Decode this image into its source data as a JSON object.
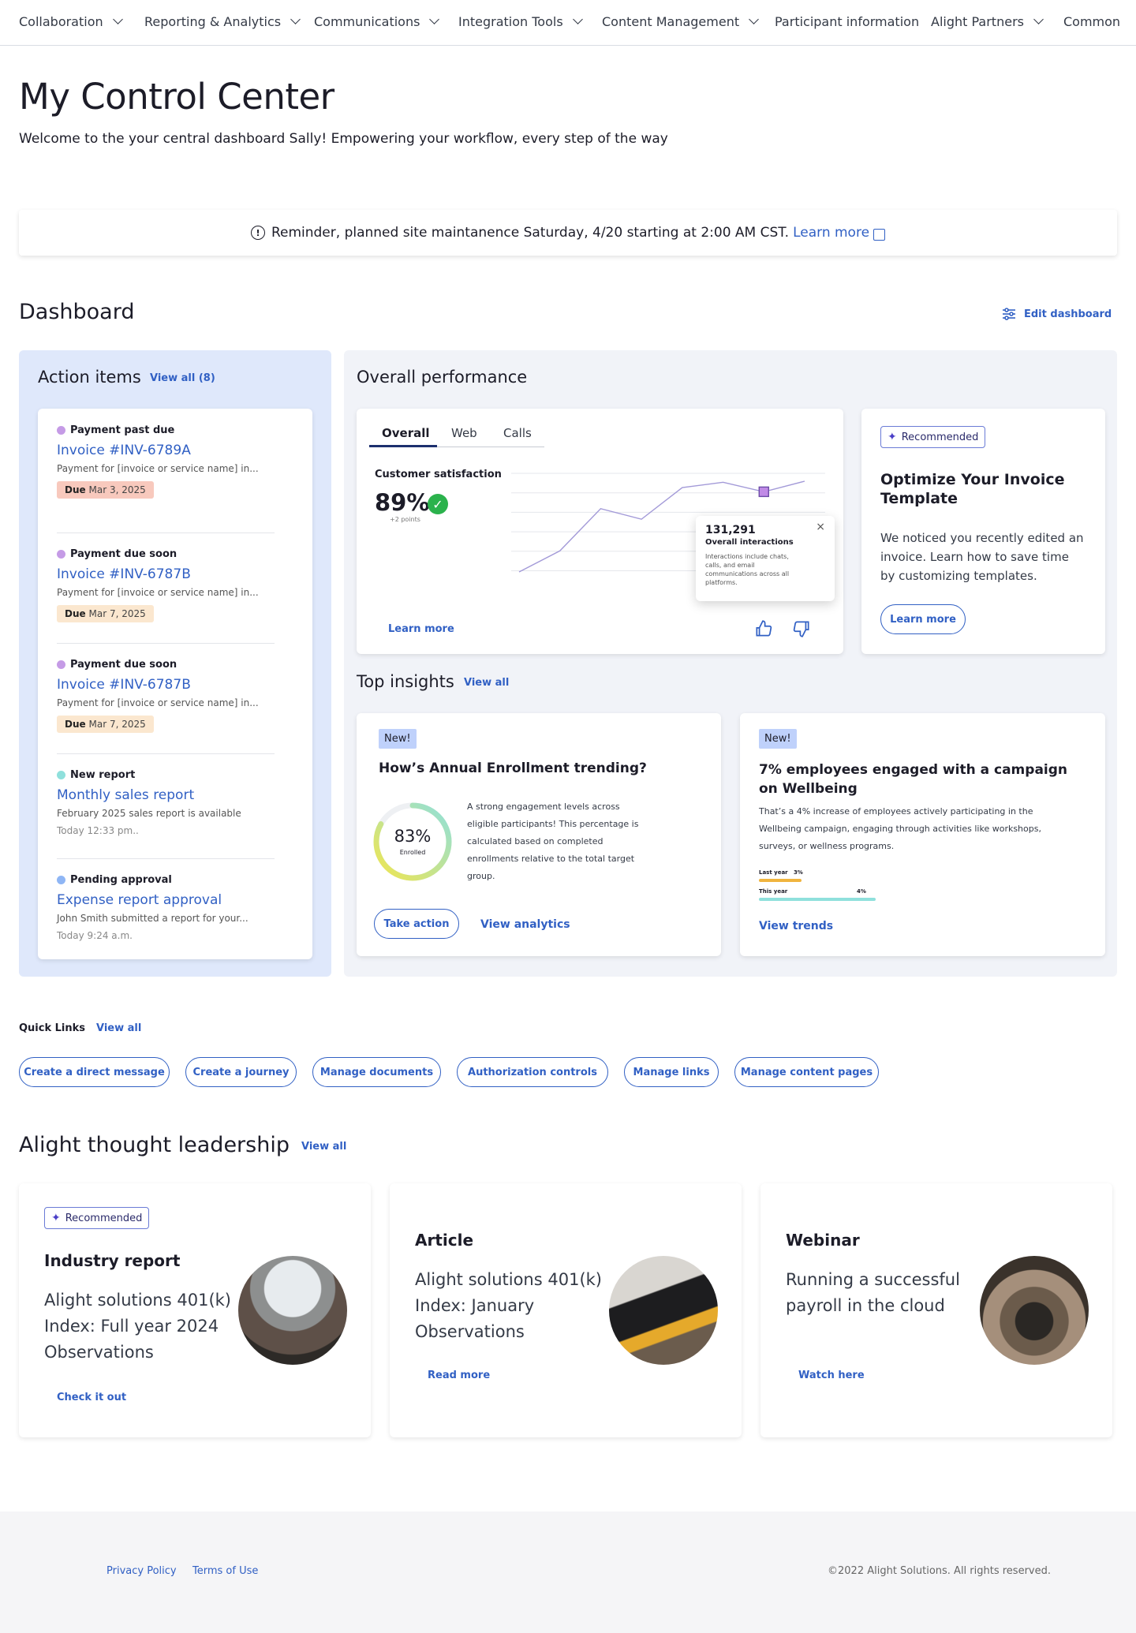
{
  "nav": {
    "items": [
      {
        "label": "Collaboration",
        "has_menu": true
      },
      {
        "label": "Reporting & Analytics",
        "has_menu": true
      },
      {
        "label": "Communications",
        "has_menu": true
      },
      {
        "label": "Integration Tools",
        "has_menu": true
      },
      {
        "label": "Content Management",
        "has_menu": true
      },
      {
        "label": "Participant information",
        "has_menu": false
      },
      {
        "label": "Alight Partners",
        "has_menu": true
      },
      {
        "label": "Common",
        "has_menu": false
      }
    ]
  },
  "page": {
    "title": "My Control Center",
    "subtitle": "Welcome to the your central dashboard Sally! Empowering your workflow, every step of the way"
  },
  "banner": {
    "text": "Reminder, planned site maintanence Saturday, 4/20 starting at 2:00 AM CST.",
    "link": "Learn more"
  },
  "dashboard": {
    "title": "Dashboard",
    "edit_label": "Edit dashboard"
  },
  "action_items": {
    "title": "Action items",
    "view_all": "View all (8)",
    "items": [
      {
        "status": "Payment past due",
        "dot": "#c59be6",
        "title": "Invoice #INV-6789A",
        "desc": "Payment for [invoice or service name] in...",
        "due_label": "Due",
        "due_date": "Mar 3, 2025",
        "due_bg": "#f8c9bd",
        "time": ""
      },
      {
        "status": "Payment due soon",
        "dot": "#c59be6",
        "title": "Invoice #INV-6787B",
        "desc": "Payment for [invoice or service name] in...",
        "due_label": "Due",
        "due_date": "Mar 7, 2025",
        "due_bg": "#fbe7cf",
        "time": ""
      },
      {
        "status": "Payment due soon",
        "dot": "#c59be6",
        "title": "Invoice #INV-6787B",
        "desc": "Payment for [invoice or service name] in...",
        "due_label": "Due",
        "due_date": "Mar 7, 2025",
        "due_bg": "#fbe7cf",
        "time": ""
      },
      {
        "status": "New report",
        "dot": "#8fe0dc",
        "title": "Monthly sales report",
        "desc": "February 2025 sales report is available",
        "due_label": "",
        "due_date": "",
        "due_bg": "",
        "time": "Today 12:33 pm.."
      },
      {
        "status": "Pending approval",
        "dot": "#8fb6f5",
        "title": "Expense report approval",
        "desc": "John Smith submitted a report for your...",
        "due_label": "",
        "due_date": "",
        "due_bg": "",
        "time": "Today 9:24 a.m."
      }
    ]
  },
  "performance": {
    "title": "Overall performance",
    "tabs": [
      "Overall",
      "Web",
      "Calls"
    ],
    "active_tab": "Overall",
    "metric_label": "Customer satisfaction",
    "metric_value": "89%",
    "metric_delta": "+2 points",
    "learn_more": "Learn more",
    "tooltip": {
      "value": "131,291",
      "label": "Overall interactions",
      "desc": "Interactions include chats, calls, and email communications across all platforms."
    }
  },
  "chart_data": {
    "type": "line",
    "values": [
      0,
      2,
      6,
      5,
      8,
      8.5,
      7.6,
      8.6
    ],
    "highlight_index": 6,
    "grid": true
  },
  "recommended": {
    "badge": "Recommended",
    "title": "Optimize Your Invoice Template",
    "body": "We noticed you recently edited an invoice. Learn how to save time by customizing templates.",
    "button": "Learn more"
  },
  "insights": {
    "title": "Top insights",
    "view_all": "View all",
    "card1": {
      "badge": "New!",
      "title": "How’s Annual Enrollment trending?",
      "percent": "83%",
      "percent_value": 0.83,
      "percent_label": "Enrolled",
      "body": "A strong engagement levels across eligible participants! This percentage is calculated based on completed enrollments relative to the total target group.",
      "primary": "Take action",
      "secondary": "View analytics"
    },
    "card2": {
      "badge": "New!",
      "title": "7% employees engaged with a campaign on Wellbeing",
      "body": "That’s a 4% increase of employees actively participating in the Wellbeing campaign, engaging through activities like workshops, surveys, or wellness programs.",
      "last_year_label": "Last year",
      "last_year_value": "3%",
      "this_year_label": "This year",
      "this_year_value": "4%",
      "last_year_num": 3,
      "this_year_num": 4,
      "link": "View trends"
    }
  },
  "quick_links": {
    "title": "Quick Links",
    "view_all": "View all",
    "items": [
      "Create a direct message",
      "Create a journey",
      "Manage documents",
      "Authorization controls",
      "Manage links",
      "Manage content pages"
    ]
  },
  "thought": {
    "title": "Alight thought leadership",
    "view_all": "View all",
    "cards": [
      {
        "badge": "Recommended",
        "type": "Industry report",
        "body": "Alight solutions 401(k) Index: Full year 2024 Observations",
        "link": "Check it out"
      },
      {
        "badge": "",
        "type": "Article",
        "body": "Alight solutions 401(k) Index: January Observations",
        "link": "Read more"
      },
      {
        "badge": "",
        "type": "Webinar",
        "body": "Running a successful payroll in the cloud",
        "link": "Watch here"
      }
    ]
  },
  "footer": {
    "privacy": "Privacy Policy",
    "terms": "Terms of Use",
    "copyright": "©2022 Alight Solutions. All rights reserved."
  },
  "colors": {
    "accent": "#3160c4",
    "action_bg": "#dfe8fb",
    "panel_bg": "#f1f3f8",
    "check": "#2bb24c",
    "chart_line": "#a39ad8",
    "ring_start": "#f1e64f",
    "ring_end": "#8fe0dc"
  }
}
